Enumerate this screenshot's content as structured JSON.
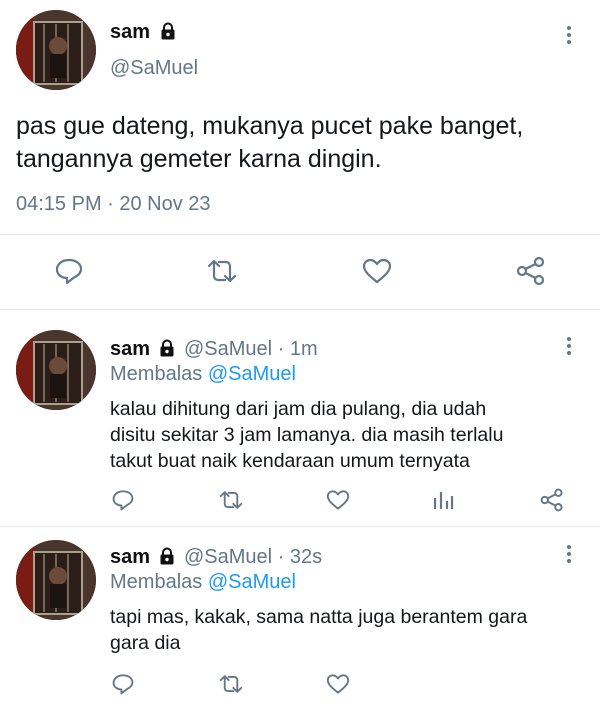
{
  "main_tweet": {
    "display_name": "sam",
    "handle": "@SaMuel",
    "text_line1": "pas gue dateng, mukanya pucet pake banget,",
    "text_line2": "tangannya gemeter karna dingin.",
    "timestamp": "04:15 PM · 20 Nov 23",
    "icons": [
      "lock-icon",
      "more-icon",
      "reply-icon",
      "retweet-icon",
      "like-icon",
      "share-icon"
    ]
  },
  "replies": [
    {
      "display_name": "sam",
      "handle_time": "@SaMuel · 1m",
      "replying_prefix": "Membalas ",
      "replying_handle": "@SaMuel",
      "lines": [
        "kalau dihitung dari jam dia pulang, dia udah",
        "disitu sekitar 3 jam lamanya. dia masih terlalu",
        "takut buat naik kendaraan umum ternyata"
      ]
    },
    {
      "display_name": "sam",
      "handle_time": "@SaMuel · 32s",
      "replying_prefix": "Membalas ",
      "replying_handle": "@SaMuel",
      "lines": [
        "tapi mas, kakak, sama natta juga berantem gara",
        "gara dia"
      ]
    }
  ],
  "colors": {
    "accent": "#1d9bf0",
    "muted": "#657786",
    "divider": "#e6ecf0"
  }
}
